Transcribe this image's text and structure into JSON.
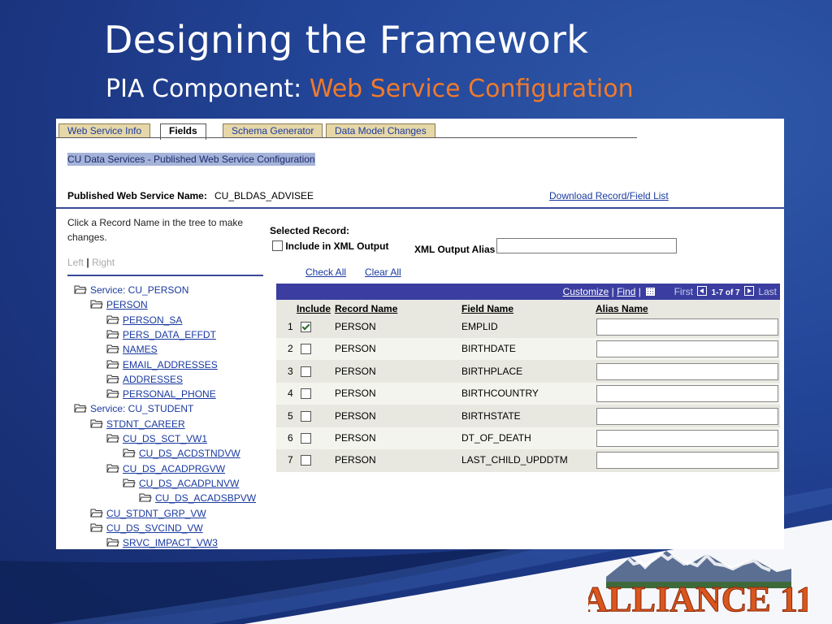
{
  "slide": {
    "title": "Designing the Framework",
    "subtitle_prefix": "PIA Component: ",
    "subtitle_accent": "Web Service Configuration"
  },
  "tabs": [
    {
      "label": "Web Service Info",
      "active": false
    },
    {
      "label": "Fields",
      "active": true
    },
    {
      "label": "Schema Generator",
      "active": false
    },
    {
      "label": "Data Model Changes",
      "active": false
    }
  ],
  "page": {
    "header": "CU Data Services - Published Web Service Configuration",
    "service_label": "Published Web Service Name:",
    "service_value": "CU_BLDAS_ADVISEE",
    "download_link": "Download Record/Field List"
  },
  "left": {
    "instructions": "Click a Record Name in the tree to make changes.",
    "left_label": "Left",
    "right_label": "Right"
  },
  "tree": [
    {
      "label": "Service: CU_PERSON",
      "link": false
    },
    {
      "label": "PERSON",
      "link": true
    },
    {
      "label": "PERSON_SA",
      "link": true
    },
    {
      "label": "PERS_DATA_EFFDT",
      "link": true
    },
    {
      "label": "NAMES",
      "link": true
    },
    {
      "label": "EMAIL_ADDRESSES",
      "link": true
    },
    {
      "label": "ADDRESSES",
      "link": true
    },
    {
      "label": "PERSONAL_PHONE",
      "link": true
    },
    {
      "label": "Service: CU_STUDENT",
      "link": false
    },
    {
      "label": "STDNT_CAREER",
      "link": true
    },
    {
      "label": "CU_DS_SCT_VW1",
      "link": true
    },
    {
      "label": "CU_DS_ACDSTNDVW",
      "link": true
    },
    {
      "label": "CU_DS_ACADPRGVW",
      "link": true
    },
    {
      "label": "CU_DS_ACADPLNVW",
      "link": true
    },
    {
      "label": "CU_DS_ACADSBPVW",
      "link": true
    },
    {
      "label": "CU_STDNT_GRP_VW",
      "link": true
    },
    {
      "label": "CU_DS_SVCIND_VW",
      "link": true
    },
    {
      "label": "SRVC_IMPACT_VW3",
      "link": true
    }
  ],
  "selected": {
    "label": "Selected Record:",
    "include_xml": "Include in XML Output",
    "include_xml_checked": false,
    "alias_label": "XML Output Alias",
    "alias_value": "",
    "check_all": "Check All",
    "clear_all": "Clear All"
  },
  "grid": {
    "customize": "Customize",
    "find": "Find",
    "sep": "|",
    "first": "First",
    "range": "1-7 of 7",
    "last": "Last",
    "columns": {
      "include": "Include",
      "record": "Record Name",
      "field": "Field Name",
      "alias": "Alias Name"
    },
    "rows": [
      {
        "num": "1",
        "checked": true,
        "record": "PERSON",
        "field": "EMPLID",
        "alias": ""
      },
      {
        "num": "2",
        "checked": false,
        "record": "PERSON",
        "field": "BIRTHDATE",
        "alias": ""
      },
      {
        "num": "3",
        "checked": false,
        "record": "PERSON",
        "field": "BIRTHPLACE",
        "alias": ""
      },
      {
        "num": "4",
        "checked": false,
        "record": "PERSON",
        "field": "BIRTHCOUNTRY",
        "alias": ""
      },
      {
        "num": "5",
        "checked": false,
        "record": "PERSON",
        "field": "BIRTHSTATE",
        "alias": ""
      },
      {
        "num": "6",
        "checked": false,
        "record": "PERSON",
        "field": "DT_OF_DEATH",
        "alias": ""
      },
      {
        "num": "7",
        "checked": false,
        "record": "PERSON",
        "field": "LAST_CHILD_UPDDTM",
        "alias": ""
      }
    ]
  },
  "logo": {
    "text": "ALLIANCE 11"
  }
}
